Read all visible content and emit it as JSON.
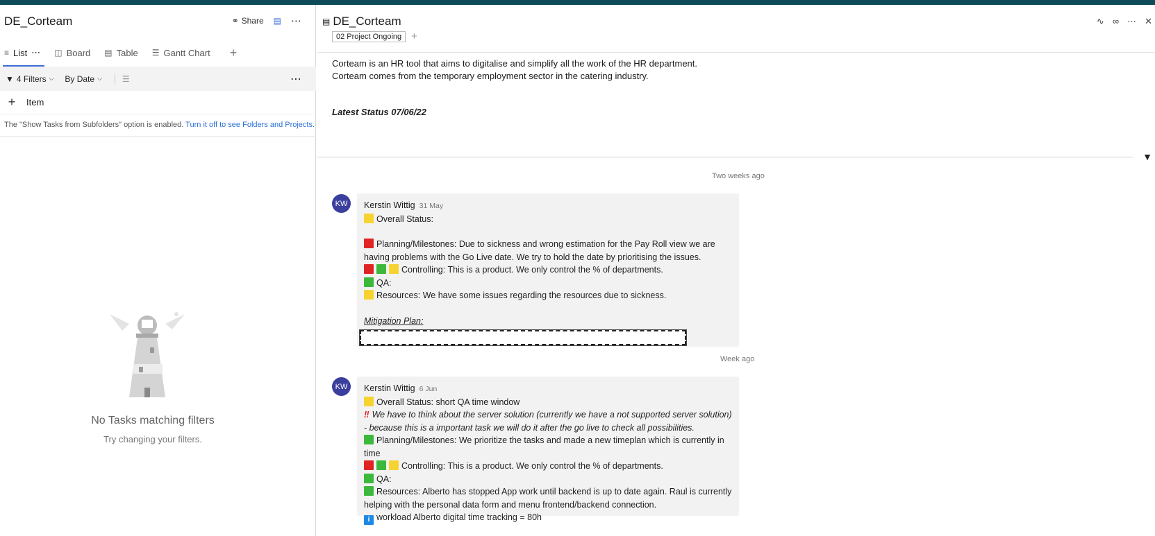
{
  "left": {
    "title": "DE_Corteam",
    "share": "Share",
    "tabs": [
      {
        "label": "List"
      },
      {
        "label": "Board"
      },
      {
        "label": "Table"
      },
      {
        "label": "Gantt Chart"
      }
    ],
    "filters": {
      "count": "4 Filters",
      "sort": "By Date"
    },
    "add_item": "Item",
    "notice": "The \"Show Tasks from Subfolders\" option is enabled.",
    "notice_link": "Turn it off to see Folders and Projects.",
    "empty_title": "No Tasks matching filters",
    "empty_sub": "Try changing your filters."
  },
  "right": {
    "title": "DE_Corteam",
    "tag": "02 Project Ongoing",
    "desc_line1": "Corteam is an HR tool that aims to digitalise and simplify all the work of the HR department.",
    "desc_line2": "Corteam comes from the temporary employment sector in the catering industry.",
    "status_head": "Latest Status 07/06/22",
    "posts": [
      {
        "timestamp": "Two weeks ago",
        "initials": "KW",
        "author": "Kerstin Wittig",
        "date": "31 May",
        "overall": "Overall Status:",
        "planning": "Planning/Milestones: Due to sickness and wrong estimation for the Pay Roll view we are having problems with the Go Live date. We try to hold the date by prioritising the issues.",
        "controlling": "Controlling: This is a product. We only control the % of departments.",
        "qa": "QA:",
        "resources": "Resources: We have some issues regarding the resources due to sickness.",
        "mitigation": "Mitigation Plan:"
      },
      {
        "timestamp": "Week ago",
        "initials": "KW",
        "author": "Kerstin Wittig",
        "date": "6 Jun",
        "overall": "Overall Status: short QA time window",
        "server": "We have to think about the server solution (currently we have a not supported server solution) - because this is a important task we will do it after the go live to check all possibilities.",
        "planning": "Planning/Milestones: We prioritize the tasks and made a new timeplan which is currently in time",
        "controlling": "Controlling: This is a product. We only control the % of departments.",
        "qa": "QA:",
        "resources": "Resources: Alberto has stopped App work until backend is up to date again. Raul is currently helping with the personal data form and menu frontend/backend connection.",
        "workload": "workload Alberto digital time tracking = 80h"
      }
    ]
  },
  "colors": {
    "accent": "#0c4b57",
    "avatar": "#3a3f9e",
    "link": "#2a6fd6"
  }
}
